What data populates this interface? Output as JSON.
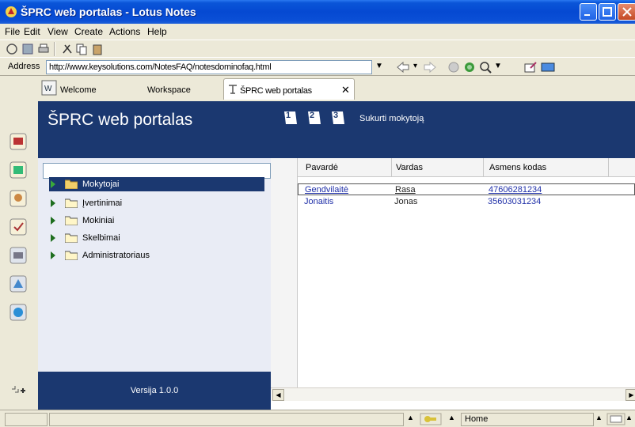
{
  "window": {
    "title": "ŠPRC web portalas - Lotus Notes",
    "title_color": "#0a4fd6"
  },
  "menu": {
    "items": [
      "File",
      "Edit",
      "View",
      "Create",
      "Actions",
      "Help"
    ]
  },
  "address": {
    "label": "Address",
    "value": "http://www.keysolutions.com/NotesFAQ/notesdominofaq.html"
  },
  "tabs": [
    {
      "label": "Welcome",
      "icon": "welcome-icon"
    },
    {
      "label": "Workspace",
      "icon": "workspace-icon"
    },
    {
      "label": "ŠPRC web portalas",
      "icon": "database-icon"
    }
  ],
  "nav": {
    "title": "ŠPRC web portalas",
    "tree": [
      {
        "label": "Mokytojai",
        "selected": true
      },
      {
        "label": "Įvertinimai",
        "selected": false
      },
      {
        "label": "Mokiniai",
        "selected": false
      },
      {
        "label": "Skelbimai",
        "selected": false
      },
      {
        "label": "Administratoriaus",
        "selected": false
      }
    ],
    "version": "Versija 1.0.0",
    "header_color": "#1b3870"
  },
  "content": {
    "action_buttons": [
      "1",
      "2",
      "3"
    ],
    "action_label": "Sukurti mokytoją",
    "columns": [
      "Pavardė",
      "Vardas",
      "Asmens kodas"
    ],
    "rows": [
      {
        "pavarde": "Gendvilaitė",
        "vardas": "Rasa",
        "kodas": "47606281234",
        "selected": true
      },
      {
        "pavarde": "Jonaitis",
        "vardas": "Jonas",
        "kodas": "35603031234",
        "selected": false
      }
    ]
  },
  "statusbar": {
    "location": "Home"
  }
}
